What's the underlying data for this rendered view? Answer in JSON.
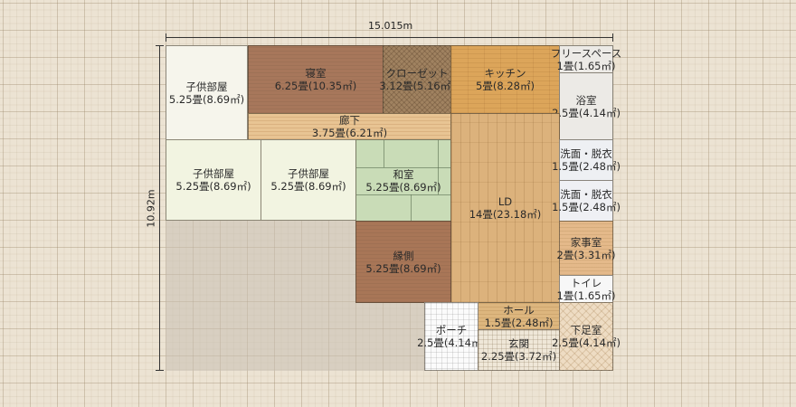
{
  "dimensions": {
    "width_label": "15.015m",
    "height_label": "10.92m"
  },
  "rooms": {
    "child1": {
      "name": "子供部屋",
      "area": "5.25畳(8.69㎡)"
    },
    "bedroom": {
      "name": "寝室",
      "area": "6.25畳(10.35㎡)"
    },
    "closet": {
      "name": "クローゼット",
      "area": "3.12畳(5.16㎡)"
    },
    "kitchen": {
      "name": "キッチン",
      "area": "5畳(8.28㎡)"
    },
    "free": {
      "name": "フリースペース",
      "area": "1畳(1.65㎡)"
    },
    "bath": {
      "name": "浴室",
      "area": "2.5畳(4.14㎡)"
    },
    "hallway": {
      "name": "廊下",
      "area": "3.75畳(6.21㎡)"
    },
    "child2": {
      "name": "子供部屋",
      "area": "5.25畳(8.69㎡)"
    },
    "child3": {
      "name": "子供部屋",
      "area": "5.25畳(8.69㎡)"
    },
    "washitsu": {
      "name": "和室",
      "area": "5.25畳(8.69㎡)"
    },
    "ld": {
      "name": "LD",
      "area": "14畳(23.18㎡)"
    },
    "wash1": {
      "name": "洗面・脱衣",
      "area": "1.5畳(2.48㎡)"
    },
    "wash2": {
      "name": "洗面・脱衣",
      "area": "1.5畳(2.48㎡)"
    },
    "kaji": {
      "name": "家事室",
      "area": "2畳(3.31㎡)"
    },
    "toilet": {
      "name": "トイレ",
      "area": "1畳(1.65㎡)"
    },
    "engawa": {
      "name": "縁側",
      "area": "5.25畳(8.69㎡)"
    },
    "hall": {
      "name": "ホール",
      "area": "1.5畳(2.48㎡)"
    },
    "porch": {
      "name": "ポーチ",
      "area": "2.5畳(4.14㎡)"
    },
    "genkan": {
      "name": "玄関",
      "area": "2.25畳(3.72㎡)"
    },
    "getabako": {
      "name": "下足室",
      "area": "2.5畳(4.14㎡)"
    }
  }
}
